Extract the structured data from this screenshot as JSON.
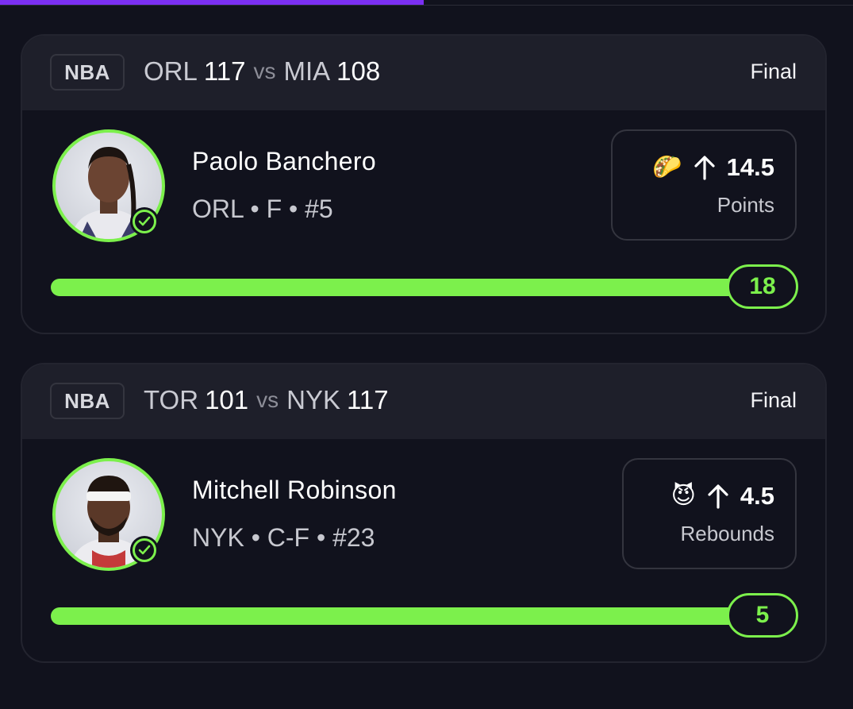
{
  "top_progress": {
    "fraction": 0.497
  },
  "cards": [
    {
      "league": "NBA",
      "home_team": "ORL",
      "home_score": "117",
      "vs": "vs",
      "away_team": "MIA",
      "away_score": "108",
      "status": "Final",
      "player": {
        "name": "Paolo Banchero",
        "meta": "ORL • F • #5",
        "hit": true
      },
      "prop": {
        "emoji": "🌮",
        "direction_icon": "arrow-up-icon",
        "line": "14.5",
        "stat": "Points"
      },
      "result": {
        "value": "18",
        "fraction": 1.0
      }
    },
    {
      "league": "NBA",
      "home_team": "TOR",
      "home_score": "101",
      "vs": "vs",
      "away_team": "NYK",
      "away_score": "117",
      "status": "Final",
      "player": {
        "name": "Mitchell Robinson",
        "meta": "NYK • C-F • #23",
        "hit": true
      },
      "prop": {
        "emoji": "😈",
        "direction_icon": "arrow-up-icon",
        "line": "4.5",
        "stat": "Rebounds"
      },
      "result": {
        "value": "5",
        "fraction": 1.0
      }
    }
  ],
  "colors": {
    "background": "#11121d",
    "header": "#1e1f2a",
    "accent_green": "#7cf04c",
    "accent_purple": "#7b2ff2"
  }
}
